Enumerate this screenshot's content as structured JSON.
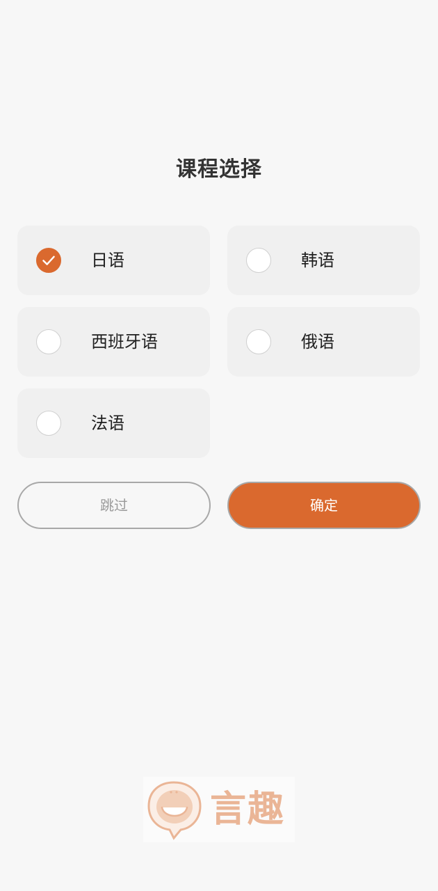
{
  "page": {
    "title": "课程选择"
  },
  "options": [
    {
      "label": "日语",
      "selected": true
    },
    {
      "label": "韩语",
      "selected": false
    },
    {
      "label": "西班牙语",
      "selected": false
    },
    {
      "label": "俄语",
      "selected": false
    },
    {
      "label": "法语",
      "selected": false
    }
  ],
  "actions": {
    "skip_label": "跳过",
    "confirm_label": "确定"
  },
  "logo": {
    "text": "言趣",
    "icon": "speech-bubble-smile-icon"
  },
  "colors": {
    "accent": "#da692e",
    "background": "#f7f7f7",
    "option_background": "#f0f0f0",
    "logo_color": "#eab596"
  }
}
